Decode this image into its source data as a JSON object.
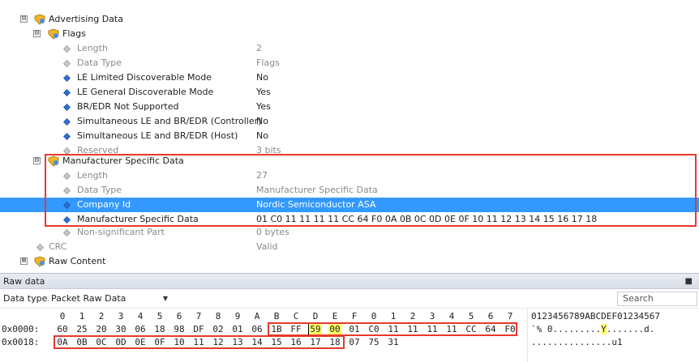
{
  "tree": {
    "advertising_data": {
      "label": "Advertising Data",
      "expander": "⊟"
    },
    "flags": {
      "label": "Flags",
      "expander": "⊟",
      "props": [
        {
          "label": "Length",
          "value": "2",
          "kind": "gray"
        },
        {
          "label": "Data Type",
          "value": "Flags",
          "kind": "gray"
        },
        {
          "label": "LE Limited Discoverable Mode",
          "value": "No",
          "kind": "blue"
        },
        {
          "label": "LE General Discoverable Mode",
          "value": "Yes",
          "kind": "blue"
        },
        {
          "label": "BR/EDR Not Supported",
          "value": "Yes",
          "kind": "blue"
        },
        {
          "label": "Simultaneous LE and BR/EDR (Controller)",
          "value": "No",
          "kind": "blue"
        },
        {
          "label": "Simultaneous LE and BR/EDR (Host)",
          "value": "No",
          "kind": "blue"
        },
        {
          "label": "Reserved",
          "value": "3 bits",
          "kind": "gray"
        }
      ]
    },
    "manufacturer": {
      "label": "Manufacturer Specific Data",
      "expander": "⊟",
      "props": [
        {
          "label": "Length",
          "value": "27",
          "kind": "gray"
        },
        {
          "label": "Data Type",
          "value": "Manufacturer Specific Data",
          "kind": "gray"
        },
        {
          "label": "Company Id",
          "value": "Nordic Semiconductor ASA",
          "kind": "blue",
          "selected": true
        },
        {
          "label": "Manufacturer Specific Data",
          "value": "01 C0 11 11 11 11 CC 64 F0 0A 0B 0C 0D 0E 0F 10 11 12 13 14 15 16 17 18",
          "kind": "blue"
        }
      ]
    },
    "non_significant": {
      "label": "Non-significant Part",
      "value": "0 bytes"
    },
    "crc": {
      "label": "CRC",
      "value": "Valid"
    },
    "raw_content": {
      "label": "Raw Content",
      "expander": "⊞"
    }
  },
  "raw_panel": {
    "title": "Raw data",
    "pin_icon": "■",
    "data_type_label": "Data type:",
    "data_type_value": "Packet Raw Data",
    "search_placeholder": "Search",
    "column_header": [
      "0",
      "1",
      "2",
      "3",
      "4",
      "5",
      "6",
      "7",
      "8",
      "9",
      "A",
      "B",
      "C",
      "D",
      "E",
      "F",
      "0",
      "1",
      "2",
      "3",
      "4",
      "5",
      "6",
      "7"
    ],
    "ascii_header": "0123456789ABCDEF01234567",
    "rows": [
      {
        "offset": "0x0000:",
        "bytes": [
          "60",
          "25",
          "20",
          "30",
          "06",
          "18",
          "98",
          "DF",
          "02",
          "01",
          "06",
          "1B",
          "FF",
          "59",
          "00",
          "01",
          "C0",
          "11",
          "11",
          "11",
          "11",
          "CC",
          "64",
          "F0"
        ],
        "ascii": "`% 0.........Y.......d."
      },
      {
        "offset": "0x0018:",
        "bytes": [
          "0A",
          "0B",
          "0C",
          "0D",
          "0E",
          "0F",
          "10",
          "11",
          "12",
          "13",
          "14",
          "15",
          "16",
          "17",
          "18",
          "07",
          "75",
          "31"
        ],
        "ascii": "...............u1"
      }
    ],
    "highlight_indices": [
      13,
      14
    ],
    "ascii_highlight": "Y"
  }
}
